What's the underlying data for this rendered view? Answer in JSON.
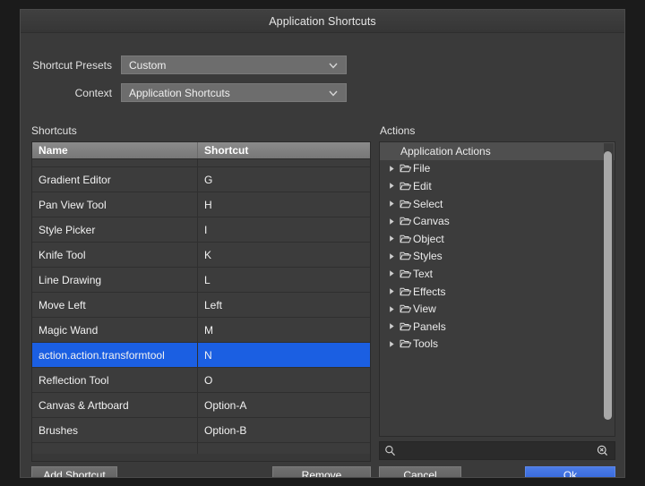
{
  "window": {
    "title": "Application Shortcuts"
  },
  "form": {
    "presets_label": "Shortcut Presets",
    "presets_value": "Custom",
    "context_label": "Context",
    "context_value": "Application Shortcuts",
    "chevron_icon": "chevron-down-icon"
  },
  "shortcuts_panel": {
    "caption": "Shortcuts",
    "columns": [
      "Name",
      "Shortcut"
    ],
    "rows": [
      {
        "name": "Gradient Editor",
        "shortcut": "G",
        "selected": false
      },
      {
        "name": "Pan View Tool",
        "shortcut": "H",
        "selected": false
      },
      {
        "name": "Style Picker",
        "shortcut": "I",
        "selected": false
      },
      {
        "name": "Knife Tool",
        "shortcut": "K",
        "selected": false
      },
      {
        "name": "Line Drawing",
        "shortcut": "L",
        "selected": false
      },
      {
        "name": "Move Left",
        "shortcut": "Left",
        "selected": false
      },
      {
        "name": "Magic Wand",
        "shortcut": "M",
        "selected": false
      },
      {
        "name": "action.action.transformtool",
        "shortcut": "N",
        "selected": true
      },
      {
        "name": "Reflection Tool",
        "shortcut": "O",
        "selected": false
      },
      {
        "name": "Canvas & Artboard",
        "shortcut": "Option-A",
        "selected": false
      },
      {
        "name": "Brushes",
        "shortcut": "Option-B",
        "selected": false
      }
    ]
  },
  "actions_panel": {
    "caption": "Actions",
    "root_label": "Application Actions",
    "folder_icon": "folder-icon",
    "expand_icon": "triangle-right-icon",
    "items": [
      {
        "label": "File"
      },
      {
        "label": "Edit"
      },
      {
        "label": "Select"
      },
      {
        "label": "Canvas"
      },
      {
        "label": "Object"
      },
      {
        "label": "Styles"
      },
      {
        "label": "Text"
      },
      {
        "label": "Effects"
      },
      {
        "label": "View"
      },
      {
        "label": "Panels"
      },
      {
        "label": "Tools"
      }
    ],
    "scrollbar": "vertical-scrollbar"
  },
  "search": {
    "value": "",
    "placeholder": "",
    "left_icon": "search-icon",
    "right_icon": "search-clear-icon"
  },
  "buttons": {
    "add_shortcut": "Add Shortcut",
    "remove": "Remove",
    "cancel": "Cancel",
    "ok": "Ok"
  },
  "colors": {
    "selection_blue": "#1b5fe2",
    "primary_button": "#2f62d8",
    "dialog_bg": "#3a3a3a",
    "panel_bg": "#3c3c3c"
  }
}
